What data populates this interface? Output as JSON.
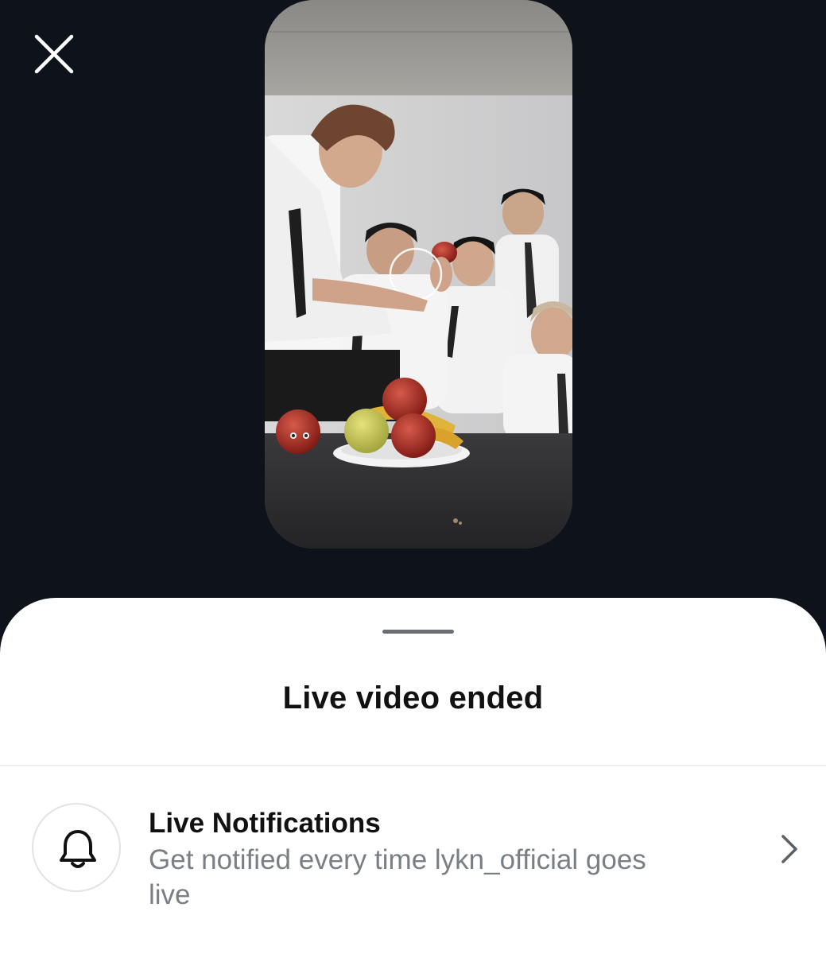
{
  "header": {
    "close_icon": "close-icon"
  },
  "video": {
    "description_icon": "live-video-preview"
  },
  "sheet": {
    "title": "Live video ended",
    "notifications": {
      "icon": "bell-icon",
      "title": "Live Notifications",
      "description": "Get notified every time lykn_official goes live",
      "chevron_icon": "chevron-right-icon"
    }
  },
  "colors": {
    "background": "#0e131b",
    "sheet": "#ffffff",
    "title_text": "#111111",
    "secondary_text": "#7a7f86"
  }
}
